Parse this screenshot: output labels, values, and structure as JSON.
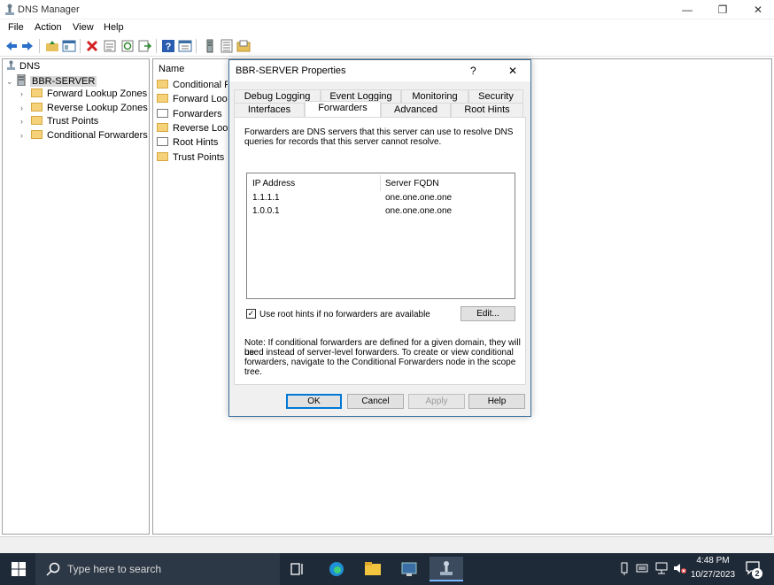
{
  "window": {
    "title": "DNS Manager",
    "controls": {
      "minimize": "—",
      "maximize": "❐",
      "close": "✕"
    }
  },
  "menu": [
    "File",
    "Action",
    "View",
    "Help"
  ],
  "toolbar_icons": [
    "back-icon",
    "forward-icon",
    "up-folder-icon",
    "show-hide-tree-icon",
    "delete-icon",
    "properties-icon",
    "refresh-icon",
    "export-icon",
    "help-icon",
    "console-icon",
    "server-icon",
    "list-icon",
    "new-zone-icon"
  ],
  "tree": {
    "root": "DNS",
    "server": "BBR-SERVER",
    "items": [
      "Forward Lookup Zones",
      "Reverse Lookup Zones",
      "Trust Points",
      "Conditional Forwarders"
    ]
  },
  "list": {
    "header": "Name",
    "rows": [
      "Conditional Fo",
      "Forward Looku",
      "Forwarders",
      "Reverse Looku",
      "Root Hints",
      "Trust Points"
    ]
  },
  "dialog": {
    "title": "BBR-SERVER Properties",
    "help": "?",
    "close": "✕",
    "tabs_row1": [
      "Debug Logging",
      "Event Logging",
      "Monitoring",
      "Security"
    ],
    "tabs_row2": [
      "Interfaces",
      "Forwarders",
      "Advanced",
      "Root Hints"
    ],
    "active_tab": "Forwarders",
    "description_line1": "Forwarders are DNS servers that this server can use to resolve DNS",
    "description_line2": "queries for records that this server cannot resolve.",
    "columns": [
      "IP Address",
      "Server FQDN"
    ],
    "forwarders": [
      {
        "ip": "1.1.1.1",
        "fqdn": "one.one.one.one"
      },
      {
        "ip": "1.0.0.1",
        "fqdn": "one.one.one.one"
      }
    ],
    "use_root_hints_label": "Use root hints if no forwarders are available",
    "use_root_hints_checked": true,
    "check_mark": "✓",
    "edit_button": "Edit...",
    "note_line1": "Note: If conditional forwarders are defined for a given domain, they will be",
    "note_line2": "used instead of server-level forwarders.  To create or view conditional",
    "note_line3": "forwarders, navigate to the Conditional Forwarders node in the scope tree.",
    "buttons": {
      "ok": "OK",
      "cancel": "Cancel",
      "apply": "Apply",
      "help": "Help"
    }
  },
  "taskbar": {
    "search_placeholder": "Type here to search",
    "time": "4:48 PM",
    "date": "10/27/2023",
    "notification_count": "2"
  },
  "colors": {
    "taskbar": "#1f2a38",
    "dialog_border": "#3a6e9a",
    "accent": "#0078d7",
    "folder": "#f5d27a"
  }
}
